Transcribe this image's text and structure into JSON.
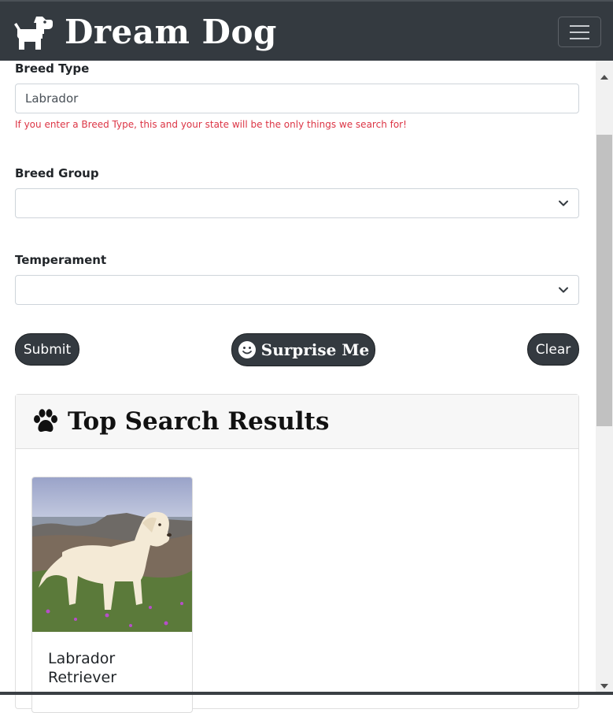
{
  "app": {
    "brand_name": "Dream Dog",
    "brand_icon": "dog-icon",
    "menu_icon": "hamburger-menu-icon",
    "colors": {
      "navbar": "#343a40",
      "button": "#343a40",
      "help_text": "#dc3545"
    }
  },
  "form": {
    "breed_type": {
      "label": "Breed Type",
      "value": "Labrador",
      "help": "If you enter a Breed Type, this and your state will be the only things we search for!"
    },
    "breed_group": {
      "label": "Breed Group",
      "selected": ""
    },
    "temperament": {
      "label": "Temperament",
      "selected": ""
    },
    "buttons": {
      "submit": "Submit",
      "surprise": "Surprise Me",
      "surprise_icon": "smile-icon",
      "clear": "Clear"
    }
  },
  "results": {
    "title": "Top Search Results",
    "title_icon": "paw-icon",
    "items": [
      {
        "name": "Labrador Retriever",
        "image": "labrador-photo"
      }
    ]
  }
}
